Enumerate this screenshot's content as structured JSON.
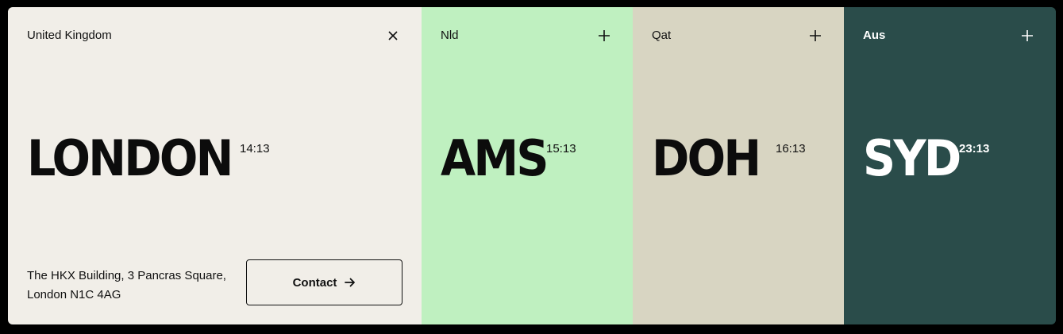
{
  "offices": [
    {
      "country": "United Kingdom",
      "city": "LONDON",
      "time": "14:13",
      "toggle_icon": "close-icon",
      "address_line1": "The HKX Building, 3 Pancras Square,",
      "address_line2": "London N1C 4AG",
      "contact_label": "Contact",
      "background": "#f1eee8"
    },
    {
      "country": "Nld",
      "city": "AMS",
      "time": "15:13",
      "toggle_icon": "plus-icon",
      "background": "#bff0c0"
    },
    {
      "country": "Qat",
      "city": "DOH",
      "time": "16:13",
      "toggle_icon": "plus-icon",
      "background": "#d8d5c2"
    },
    {
      "country": "Aus",
      "city": "SYD",
      "time": "23:13",
      "toggle_icon": "plus-icon",
      "background": "#2a4c4a"
    }
  ]
}
